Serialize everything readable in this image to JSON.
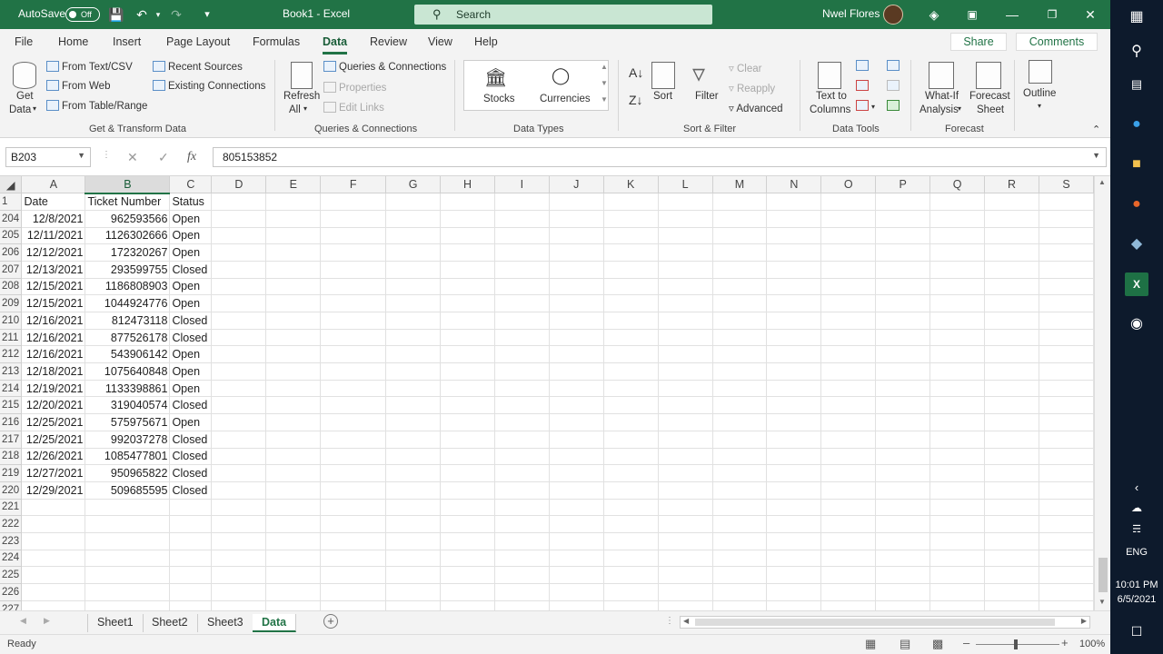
{
  "titlebar": {
    "autosave_label": "AutoSave",
    "autosave_state": "Off",
    "document_title": "Book1  -  Excel",
    "search_placeholder": "Search",
    "user_name": "Nwel Flores",
    "accent_color": "#217346"
  },
  "menu": {
    "tabs": [
      "File",
      "Home",
      "Insert",
      "Page Layout",
      "Formulas",
      "Data",
      "Review",
      "View",
      "Help"
    ],
    "active_tab": "Data",
    "share_label": "Share",
    "comments_label": "Comments"
  },
  "ribbon": {
    "get_transform": {
      "get_data": "Get",
      "get_data2": "Data",
      "from_text_csv": "From Text/CSV",
      "from_web": "From Web",
      "from_table_range": "From Table/Range",
      "recent_sources": "Recent Sources",
      "existing_connections": "Existing Connections",
      "label": "Get & Transform Data"
    },
    "queries": {
      "refresh": "Refresh",
      "refresh_all": "All",
      "queries_connections": "Queries & Connections",
      "properties": "Properties",
      "edit_links": "Edit Links",
      "label": "Queries & Connections"
    },
    "data_types": {
      "stocks": "Stocks",
      "currencies": "Currencies",
      "label": "Data Types"
    },
    "sort_filter": {
      "sort": "Sort",
      "filter": "Filter",
      "clear": "Clear",
      "reapply": "Reapply",
      "advanced": "Advanced",
      "label": "Sort & Filter"
    },
    "data_tools": {
      "text_to": "Text to",
      "columns": "Columns",
      "label": "Data Tools"
    },
    "forecast": {
      "what_if": "What-If",
      "analysis": "Analysis",
      "forecast": "Forecast",
      "sheet": "Sheet",
      "label": "Forecast"
    },
    "outline": {
      "outline": "Outline"
    }
  },
  "formula_bar": {
    "name_box": "B203",
    "fx": "fx",
    "value": "805153852"
  },
  "grid": {
    "columns": [
      "A",
      "B",
      "C",
      "D",
      "E",
      "F",
      "G",
      "H",
      "I",
      "J",
      "K",
      "L",
      "M",
      "N",
      "O",
      "P",
      "Q",
      "R",
      "S"
    ],
    "selected_column": "B",
    "header_row": {
      "num": "1",
      "date": "Date",
      "ticket": "Ticket Number",
      "status": "Status"
    },
    "rows": [
      {
        "num": "204",
        "date": "12/8/2021",
        "ticket": "962593566",
        "status": "Open"
      },
      {
        "num": "205",
        "date": "12/11/2021",
        "ticket": "1126302666",
        "status": "Open"
      },
      {
        "num": "206",
        "date": "12/12/2021",
        "ticket": "172320267",
        "status": "Open"
      },
      {
        "num": "207",
        "date": "12/13/2021",
        "ticket": "293599755",
        "status": "Closed"
      },
      {
        "num": "208",
        "date": "12/15/2021",
        "ticket": "1186808903",
        "status": "Open"
      },
      {
        "num": "209",
        "date": "12/15/2021",
        "ticket": "1044924776",
        "status": "Open"
      },
      {
        "num": "210",
        "date": "12/16/2021",
        "ticket": "812473118",
        "status": "Closed"
      },
      {
        "num": "211",
        "date": "12/16/2021",
        "ticket": "877526178",
        "status": "Closed"
      },
      {
        "num": "212",
        "date": "12/16/2021",
        "ticket": "543906142",
        "status": "Open"
      },
      {
        "num": "213",
        "date": "12/18/2021",
        "ticket": "1075640848",
        "status": "Open"
      },
      {
        "num": "214",
        "date": "12/19/2021",
        "ticket": "1133398861",
        "status": "Open"
      },
      {
        "num": "215",
        "date": "12/20/2021",
        "ticket": "319040574",
        "status": "Closed"
      },
      {
        "num": "216",
        "date": "12/25/2021",
        "ticket": "575975671",
        "status": "Open"
      },
      {
        "num": "217",
        "date": "12/25/2021",
        "ticket": "992037278",
        "status": "Closed"
      },
      {
        "num": "218",
        "date": "12/26/2021",
        "ticket": "1085477801",
        "status": "Closed"
      },
      {
        "num": "219",
        "date": "12/27/2021",
        "ticket": "950965822",
        "status": "Closed"
      },
      {
        "num": "220",
        "date": "12/29/2021",
        "ticket": "509685595",
        "status": "Closed"
      }
    ],
    "empty_rows": [
      "221",
      "222",
      "223",
      "224",
      "225",
      "226",
      "227"
    ]
  },
  "sheets": {
    "tabs": [
      "Sheet1",
      "Sheet2",
      "Sheet3",
      "Data"
    ],
    "active": "Data"
  },
  "status": {
    "ready": "Ready",
    "zoom": "100%"
  },
  "taskbar": {
    "lang": "ENG",
    "time": "10:01 PM",
    "date": "6/5/2021"
  }
}
